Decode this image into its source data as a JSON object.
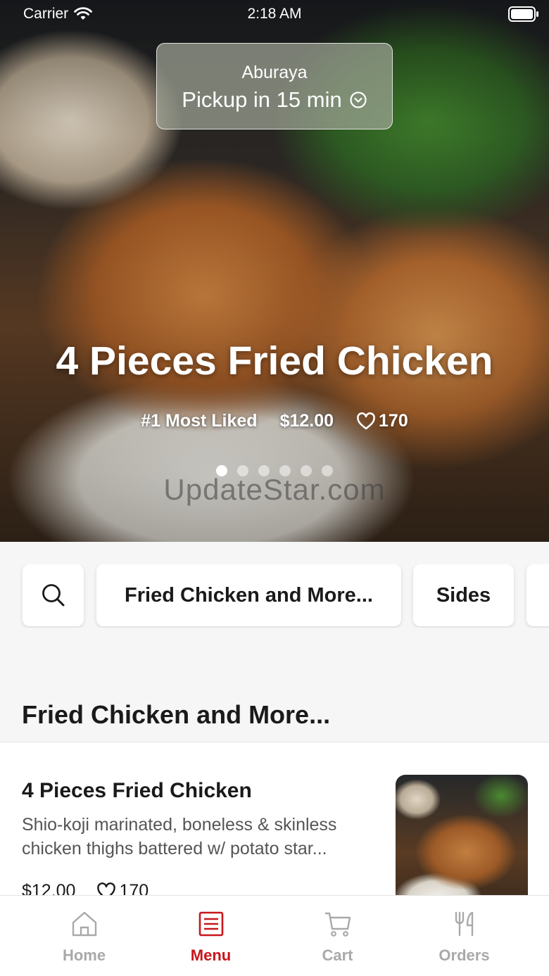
{
  "status_bar": {
    "carrier": "Carrier",
    "time": "2:18 AM"
  },
  "pickup": {
    "store": "Aburaya",
    "time_label": "Pickup in 15 min"
  },
  "hero": {
    "title": "4 Pieces Fried Chicken",
    "badge": "#1 Most Liked",
    "price": "$12.00",
    "likes": "170",
    "slide_count": 6,
    "active_slide": 1
  },
  "watermark": "UpdateStar.com",
  "categories": [
    {
      "label": "Fried Chicken and More..."
    },
    {
      "label": "Sides"
    }
  ],
  "section": {
    "title": "Fried Chicken and More..."
  },
  "menu_item": {
    "name": "4 Pieces Fried Chicken",
    "description": "Shio-koji marinated, boneless & skinless chicken thighs battered w/ potato star...",
    "price": "$12.00",
    "likes": "170"
  },
  "tabs": [
    {
      "label": "Home",
      "icon": "home-icon",
      "active": false
    },
    {
      "label": "Menu",
      "icon": "menu-icon",
      "active": true
    },
    {
      "label": "Cart",
      "icon": "cart-icon",
      "active": false
    },
    {
      "label": "Orders",
      "icon": "fork-knife-icon",
      "active": false
    }
  ],
  "colors": {
    "accent": "#c8161d",
    "inactive_tab": "#a9a9a9",
    "background": "#f6f6f6"
  }
}
